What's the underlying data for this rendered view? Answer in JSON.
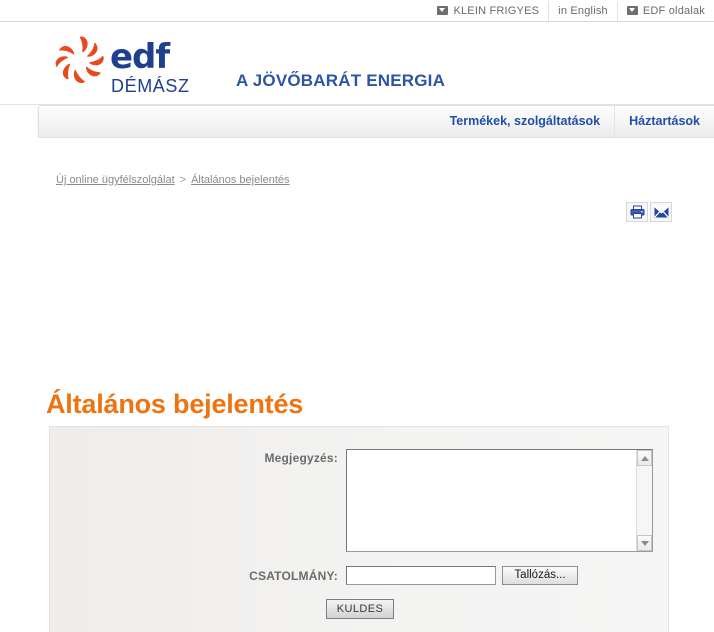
{
  "topbar": {
    "items": [
      {
        "label": "KLEIN FRIGYES",
        "icon": "dropdown-icon",
        "has_icon": true
      },
      {
        "label": "in English",
        "icon": "",
        "has_icon": false
      },
      {
        "label": "EDF oldalak",
        "icon": "dropdown-icon",
        "has_icon": true
      }
    ]
  },
  "branding": {
    "logo_word": "edf",
    "logo_sub": "DÉMÁSZ",
    "tagline": "A JÖVŐBARÁT ENERGIA",
    "logo_icon": "edf-sunburst-logo",
    "colors": {
      "logo_blue": "#1f3f8f",
      "logo_orange": "#e8491f",
      "tagline_blue": "#2c55a6",
      "title_orange": "#ee7411"
    }
  },
  "nav": {
    "items": [
      {
        "label": "Termékek, szolgáltatások"
      },
      {
        "label": "Háztartások"
      }
    ]
  },
  "breadcrumb": {
    "items": [
      {
        "label": "Új online ügyfélszolgálat"
      },
      {
        "label": "Általános bejelentés"
      }
    ],
    "separator": ">"
  },
  "tools": [
    {
      "name": "print-icon",
      "title": "Nyomtatás"
    },
    {
      "name": "mail-icon",
      "title": "E-mail"
    }
  ],
  "page": {
    "title": "Általános bejelentés"
  },
  "form": {
    "comment": {
      "label": "Megjegyzés:",
      "value": "",
      "placeholder": ""
    },
    "attachment": {
      "label": "CSATOLMÁNY:",
      "value": "",
      "placeholder": "",
      "browse_label": "Tallózás..."
    },
    "submit_label": "KULDES"
  }
}
